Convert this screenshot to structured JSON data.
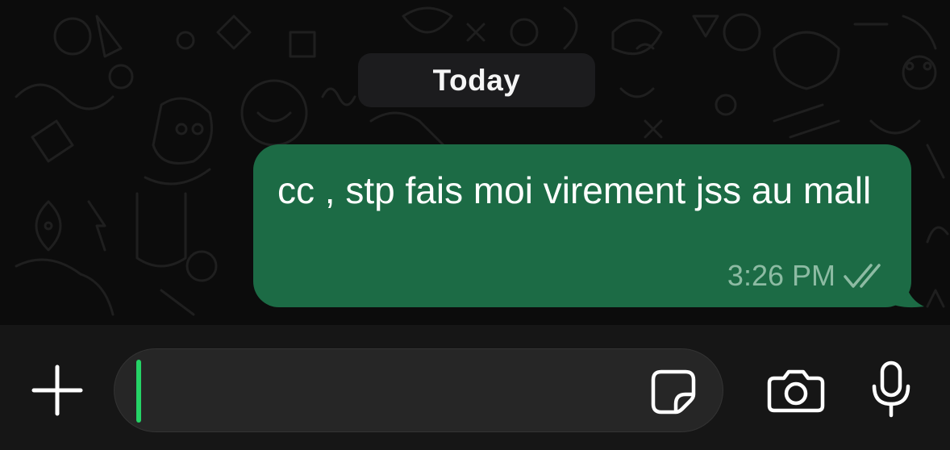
{
  "conversation": {
    "date_separator": "Today",
    "messages": [
      {
        "direction": "outgoing",
        "text": "cc , stp fais moi virement jss au mall",
        "time": "3:26 PM",
        "status": "read-double-check"
      }
    ]
  },
  "composer": {
    "input_value": "",
    "icons": {
      "attach": "plus-icon",
      "sticker": "sticker-icon",
      "camera": "camera-icon",
      "microphone": "microphone-icon"
    }
  },
  "colors": {
    "background": "#0c0c0c",
    "outgoing_bubble": "#1c6b45",
    "accent_caret": "#25d366",
    "date_pill": "#1c1c1e",
    "input_bar": "#161616"
  }
}
